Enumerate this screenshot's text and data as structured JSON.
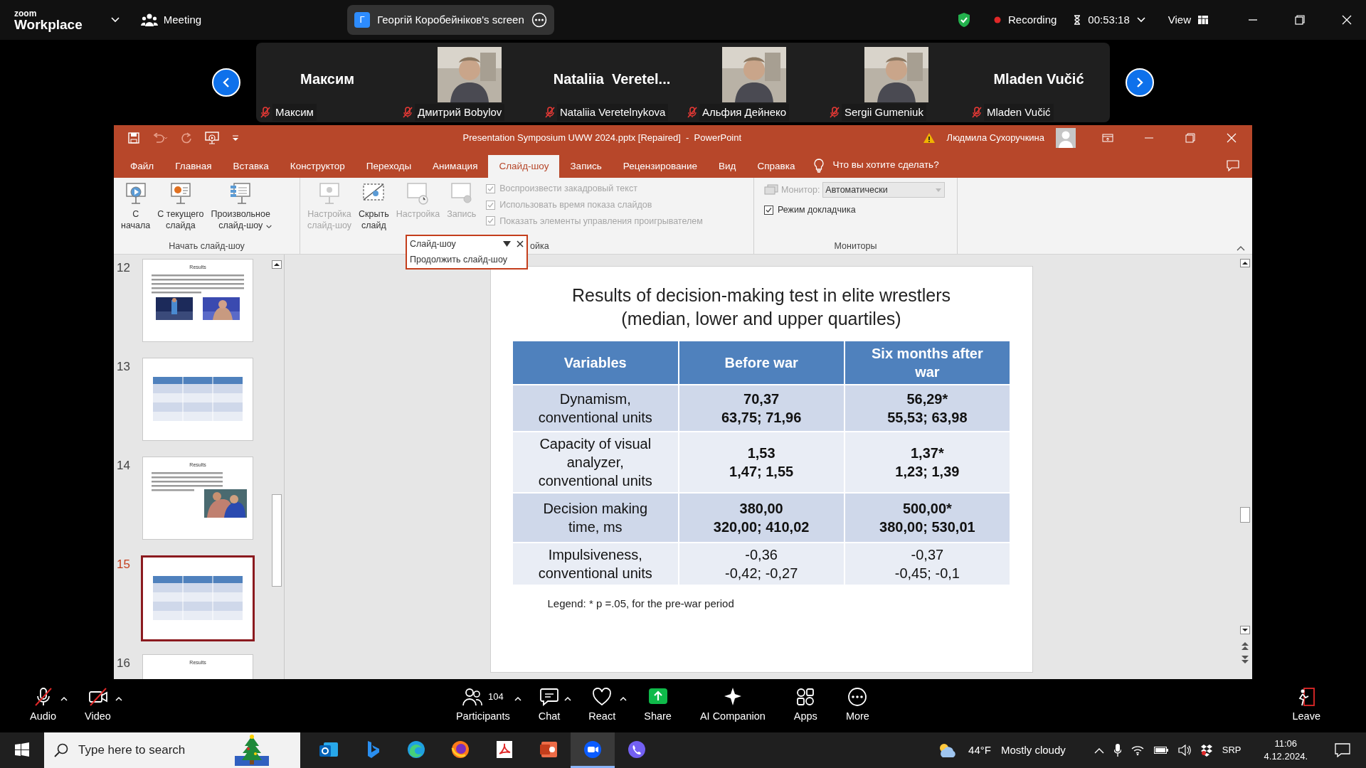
{
  "zoom": {
    "logo_top": "zoom",
    "logo_bottom": "Workplace",
    "meeting": "Meeting",
    "share": {
      "initial": "Г",
      "label": "Георгій Коробейніков's screen"
    },
    "recording": "Recording",
    "timer": "00:53:18",
    "view": "View"
  },
  "participants": [
    {
      "kind": "name",
      "title": "Максим",
      "name": "Максим"
    },
    {
      "kind": "picture",
      "name": "Дмитрий Bobylov"
    },
    {
      "kind": "name",
      "title": "Nataliia  Veretel...",
      "name": "Nataliia Veretelnykova"
    },
    {
      "kind": "picture",
      "name": "Альфия Дейнеко"
    },
    {
      "kind": "picture",
      "name": "Sergii Gumeniuk"
    },
    {
      "kind": "name",
      "title": "Mladen Vučić",
      "name": "Mladen Vučić"
    }
  ],
  "powerpoint": {
    "title": "Presentation Symposium UWW 2024.pptx [Repaired]  -  PowerPoint",
    "user": "Людмила Сухоручкина",
    "tabs": [
      {
        "label": "Файл",
        "selected": false
      },
      {
        "label": "Главная",
        "selected": false
      },
      {
        "label": "Вставка",
        "selected": false
      },
      {
        "label": "Конструктор",
        "selected": false
      },
      {
        "label": "Переходы",
        "selected": false
      },
      {
        "label": "Анимация",
        "selected": false
      },
      {
        "label": "Слайд-шоу",
        "selected": true
      },
      {
        "label": "Запись",
        "selected": false
      },
      {
        "label": "Рецензирование",
        "selected": false
      },
      {
        "label": "Вид",
        "selected": false
      },
      {
        "label": "Справка",
        "selected": false
      }
    ],
    "tell_me": "Что вы хотите сделать?",
    "groups": [
      {
        "label": "Начать слайд-шоу",
        "buttons": [
          {
            "kind": "play",
            "lines": [
              "С",
              "начала"
            ],
            "disabled": false,
            "dropdown": false
          },
          {
            "kind": "current",
            "lines": [
              "С текущего",
              "слайда"
            ],
            "disabled": false,
            "dropdown": false
          },
          {
            "kind": "custom",
            "lines": [
              "Произвольное",
              "слайд-шоу"
            ],
            "disabled": false,
            "dropdown": true
          }
        ]
      },
      {
        "label": "ойка",
        "buttons": [
          {
            "kind": "setup",
            "lines": [
              "Настройка",
              "слайд-шоу"
            ],
            "disabled": true,
            "dropdown": false
          },
          {
            "kind": "hide",
            "lines": [
              "Скрыть",
              "слайд"
            ],
            "disabled": false,
            "dropdown": false
          },
          {
            "kind": "timing",
            "lines": [
              "Настройка"
            ],
            "disabled": true,
            "dropdown": false
          },
          {
            "kind": "record",
            "lines": [
              "Запись"
            ],
            "disabled": true,
            "dropdown": false
          }
        ],
        "checks": [
          {
            "label": "Воспроизвести закадровый текст",
            "checked": true,
            "disabled": true
          },
          {
            "label": "Использовать время показа слайдов",
            "checked": true,
            "disabled": true
          },
          {
            "label": "Показать элементы управления проигрывателем",
            "checked": true,
            "disabled": true
          }
        ]
      },
      {
        "label": "Мониторы",
        "monitor": {
          "label": "Монитор:",
          "value": "Автоматически"
        },
        "checks": [
          {
            "label": "Режим докладчика",
            "checked": true,
            "disabled": false
          }
        ]
      }
    ],
    "popup": {
      "title": "Слайд-шоу",
      "item": "Продолжить слайд-шоу"
    },
    "thumbnails": [
      {
        "number": "12",
        "kind": "text_photos",
        "title": "Results",
        "selected": false
      },
      {
        "number": "13",
        "kind": "table",
        "selected": false
      },
      {
        "number": "14",
        "kind": "text_photo",
        "title": "Results",
        "selected": false
      },
      {
        "number": "15",
        "kind": "table",
        "selected": true
      },
      {
        "number": "16",
        "kind": "title",
        "title": "Results",
        "selected": false
      }
    ],
    "slide": {
      "title": [
        "Results of decision-making test in elite wrestlers",
        "(median, lower and upper quartiles)"
      ],
      "columns": [
        {
          "lines": [
            "Variables"
          ]
        },
        {
          "lines": [
            "Before war"
          ]
        },
        {
          "lines": [
            "Six months after",
            "war"
          ]
        }
      ],
      "rows": [
        {
          "bold": true,
          "cells": [
            {
              "lines": [
                "Dynamism,",
                "conventional units"
              ]
            },
            {
              "lines": [
                "70,37",
                "63,75; 71,96"
              ]
            },
            {
              "lines": [
                "56,29*",
                "55,53; 63,98"
              ]
            }
          ]
        },
        {
          "bold": true,
          "cells": [
            {
              "lines": [
                "Capacity of visual",
                "analyzer,",
                "conventional units"
              ]
            },
            {
              "lines": [
                "1,53",
                "1,47; 1,55"
              ]
            },
            {
              "lines": [
                "1,37*",
                "1,23; 1,39"
              ]
            }
          ]
        },
        {
          "bold": true,
          "cells": [
            {
              "lines": [
                "Decision making",
                "time, ms"
              ]
            },
            {
              "lines": [
                "380,00",
                "320,00; 410,02"
              ]
            },
            {
              "lines": [
                "500,00*",
                "380,00; 530,01"
              ]
            }
          ]
        },
        {
          "bold": false,
          "cells": [
            {
              "lines": [
                "Impulsiveness,",
                "conventional units"
              ]
            },
            {
              "lines": [
                "-0,36",
                "-0,42; -0,27"
              ]
            },
            {
              "lines": [
                "-0,37",
                "-0,45; -0,1"
              ]
            }
          ]
        }
      ],
      "legend": "Legend: * p =.05, for the pre-war period"
    }
  },
  "toolbar": [
    {
      "kind": "mic",
      "label": "Audio",
      "off": true,
      "caret": true
    },
    {
      "kind": "camera",
      "label": "Video",
      "off": true,
      "caret": true
    },
    {
      "kind": "people",
      "label": "Participants",
      "count": "104",
      "off": false,
      "caret": true
    },
    {
      "kind": "chat",
      "label": "Chat",
      "off": false,
      "caret": true
    },
    {
      "kind": "heart",
      "label": "React",
      "off": false,
      "caret": true
    },
    {
      "kind": "share",
      "label": "Share",
      "off": false,
      "caret": false
    },
    {
      "kind": "sparkle",
      "label": "AI Companion",
      "off": false,
      "caret": false
    },
    {
      "kind": "apps",
      "label": "Apps",
      "off": false,
      "caret": false
    },
    {
      "kind": "more",
      "label": "More",
      "off": false,
      "caret": false
    },
    {
      "kind": "leave",
      "label": "Leave",
      "off": false,
      "caret": false
    }
  ],
  "taskbar": {
    "search_placeholder": "Type here to search",
    "apps": [
      {
        "kind": "mail",
        "active": false
      },
      {
        "kind": "b",
        "active": false
      },
      {
        "kind": "edge",
        "active": false
      },
      {
        "kind": "fox",
        "active": false
      },
      {
        "kind": "pdf",
        "active": false
      },
      {
        "kind": "slides",
        "active": false
      },
      {
        "kind": "camera",
        "active": true
      },
      {
        "kind": "phone",
        "active": false
      }
    ],
    "temperature": "44°F",
    "weather": "Mostly cloudy",
    "language": "SRP",
    "time": "11:06",
    "date": "4.12.2024."
  }
}
